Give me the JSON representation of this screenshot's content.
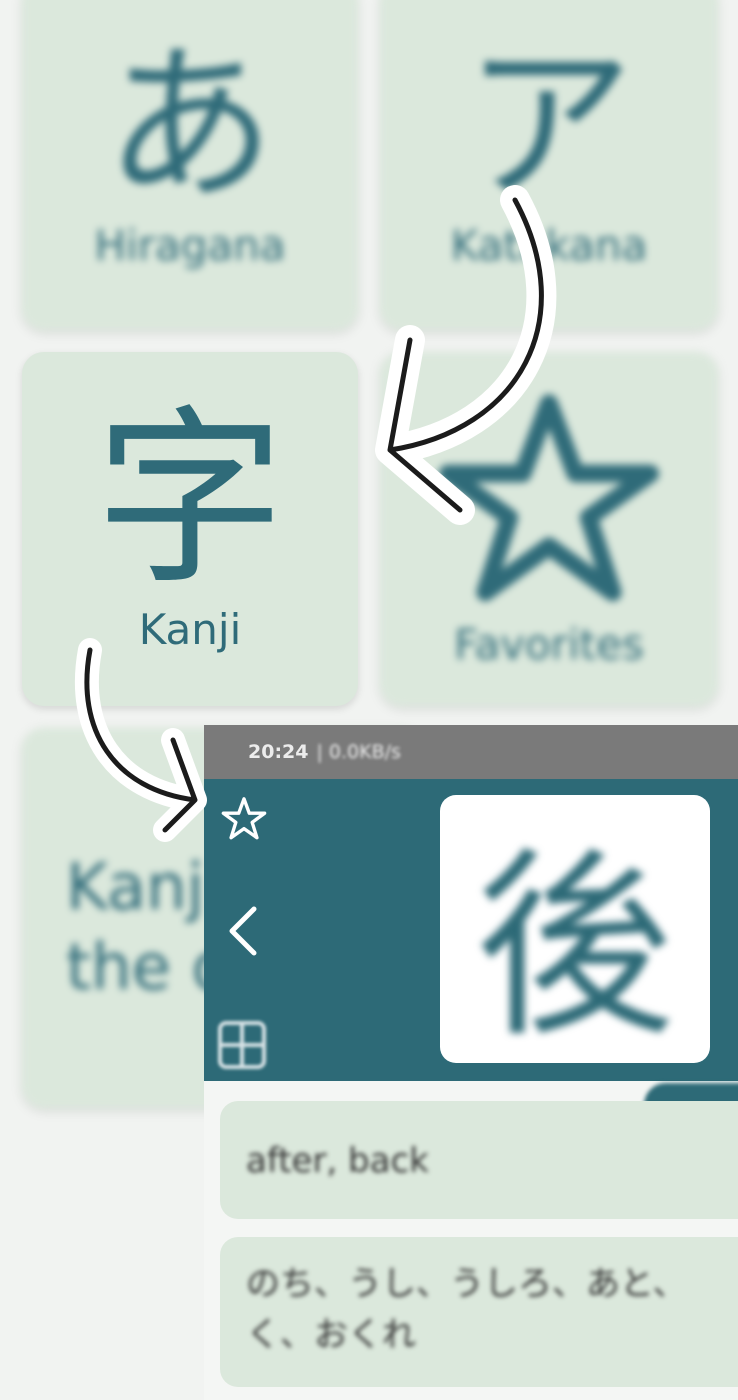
{
  "menu": {
    "hiragana": {
      "glyph": "あ",
      "label": "Hiragana"
    },
    "katakana": {
      "glyph": "ア",
      "label": "Katakana"
    },
    "kanji": {
      "glyph": "字",
      "label": "Kanji"
    },
    "favorites": {
      "label": "Favorites"
    },
    "kanji_of_day": {
      "line1": "Kanj",
      "line2": "the d"
    }
  },
  "inset": {
    "status": {
      "time": "20:24",
      "speed": "| 0.0KB/s"
    },
    "kanji": "後",
    "meaning": "after, back",
    "reading_line1": "のち、うし、うしろ、あと、",
    "reading_line2": "く、おくれ"
  },
  "colors": {
    "accent": "#2d6a77",
    "card": "#dbe8dc"
  },
  "icons": [
    "star-icon",
    "back-icon",
    "grid-icon",
    "arrow-icon"
  ]
}
